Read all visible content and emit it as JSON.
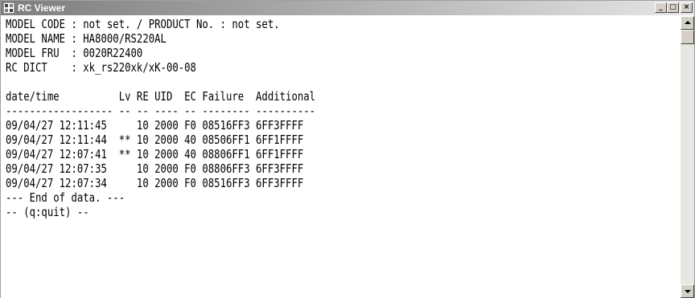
{
  "window": {
    "title": "RC Viewer",
    "minimize_label": "_",
    "maximize_label": "□",
    "close_label": "×",
    "app_icon": "rc-viewer-app-icon"
  },
  "console": {
    "header": [
      "MODEL CODE : not set. / PRODUCT No. : not set.",
      "MODEL NAME : HA8000/RS220AL",
      "MODEL FRU  : 0020R22400",
      "RC DICT    : xk_rs220xk/xK-00-08"
    ],
    "blank": "",
    "table_header": "date/time          Lv RE UID  EC Failure  Additional",
    "table_separator": "------------------ -- -- ---- -- -------- ----------",
    "rows": [
      "09/04/27 12:11:45     10 2000 F0 08516FF3 6FF3FFFF",
      "09/04/27 12:11:44  ** 10 2000 40 08506FF1 6FF1FFFF",
      "09/04/27 12:07:41  ** 10 2000 40 08806FF1 6FF1FFFF",
      "09/04/27 12:07:35     10 2000 F0 08806FF3 6FF3FFFF",
      "09/04/27 12:07:34     10 2000 F0 08516FF3 6FF3FFFF"
    ],
    "end_marker": "--- End of data. ---",
    "prompt": "-- (q:quit) --"
  },
  "colors": {
    "background": "#ffffff",
    "text": "#000000"
  }
}
